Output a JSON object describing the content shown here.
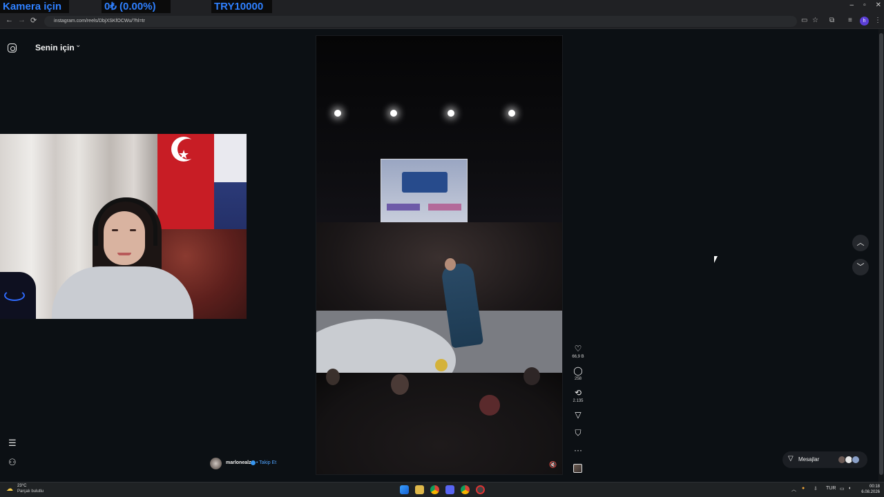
{
  "overlay": {
    "left_text": "Kamera için",
    "mid_text": "0₺ (0.00%)",
    "right_text": "TRY10000",
    "accent": "#2f80ff"
  },
  "browser": {
    "url": "instagram.com/reels/DbjXSKfOCWu/?hl=tr",
    "back_icon": "←",
    "forward_icon": "→",
    "reload_icon": "⟳",
    "profile_initial": "h",
    "min_icon": "–",
    "restore_icon": "▫",
    "close_icon": "✕"
  },
  "sidebar": {
    "feed_title": "Senin için",
    "caret": "⌄",
    "menu_icon": "☰",
    "meta_icon": "⚇"
  },
  "reel": {
    "owner": "marlonealz",
    "follow_label": "• Takip Et",
    "mute_icon": "🔇",
    "actions": [
      {
        "name": "like",
        "icon": "♡",
        "count": "66,9 B"
      },
      {
        "name": "comment",
        "icon": "◯",
        "count": "258"
      },
      {
        "name": "repost",
        "icon": "⟲",
        "count": "2.135"
      },
      {
        "name": "share",
        "icon": "▽",
        "count": ""
      },
      {
        "name": "save",
        "icon": "⛉",
        "count": ""
      },
      {
        "name": "more",
        "icon": "···",
        "count": ""
      }
    ]
  },
  "nav": {
    "up_icon": "︿",
    "down_icon": "﹀"
  },
  "messages": {
    "label": "Mesajlar",
    "icon": "▽"
  },
  "taskbar": {
    "temperature": "23°C",
    "condition": "Parçalı bulutlu",
    "lang": "TUR",
    "time": "00:18",
    "date": "6.08.2026",
    "tray_up": "︿"
  }
}
